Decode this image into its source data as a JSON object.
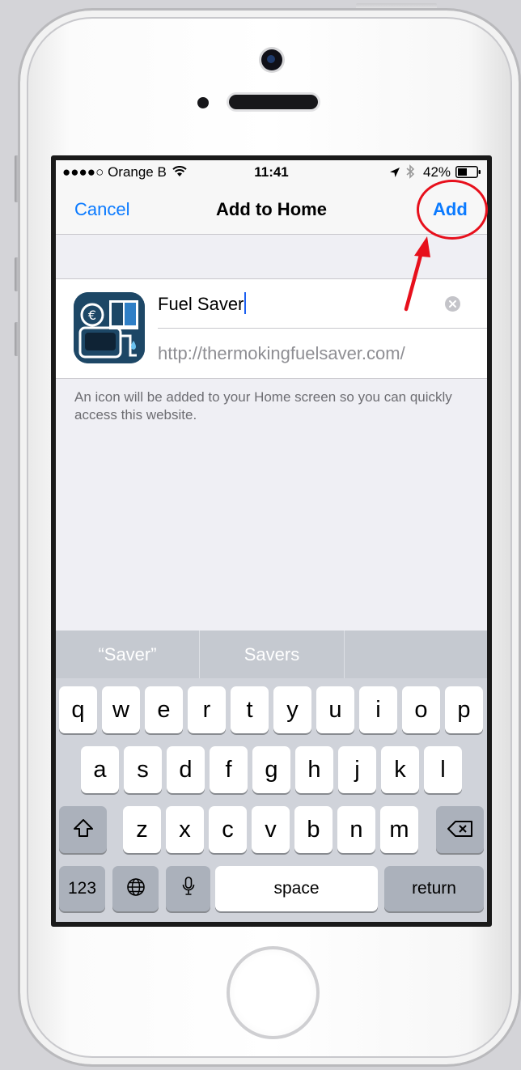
{
  "status_bar": {
    "carrier": "●●●●○ Orange B",
    "time": "11:41",
    "battery": "42%"
  },
  "nav": {
    "cancel": "Cancel",
    "title": "Add to Home",
    "add": "Add"
  },
  "form": {
    "name_value": "Fuel Saver",
    "url": "http://thermokingfuelsaver.com/",
    "helper": "An icon will be added to your Home screen so you can quickly access this website."
  },
  "keyboard": {
    "suggestions": [
      "“Saver”",
      "Savers",
      ""
    ],
    "row1": [
      "q",
      "w",
      "e",
      "r",
      "t",
      "y",
      "u",
      "i",
      "o",
      "p"
    ],
    "row2": [
      "a",
      "s",
      "d",
      "f",
      "g",
      "h",
      "j",
      "k",
      "l"
    ],
    "row3": [
      "z",
      "x",
      "c",
      "v",
      "b",
      "n",
      "m"
    ],
    "numbers_key": "123",
    "space_key": "space",
    "return_key": "return"
  },
  "colors": {
    "ios_blue": "#0a7aff",
    "annotation_red": "#e7101c",
    "icon_navy": "#1d4766"
  },
  "icons": [
    "location-arrow-icon",
    "bluetooth-icon",
    "battery-icon",
    "wifi-icon",
    "clear-icon",
    "shift-icon",
    "globe-icon",
    "microphone-icon",
    "delete-icon"
  ]
}
